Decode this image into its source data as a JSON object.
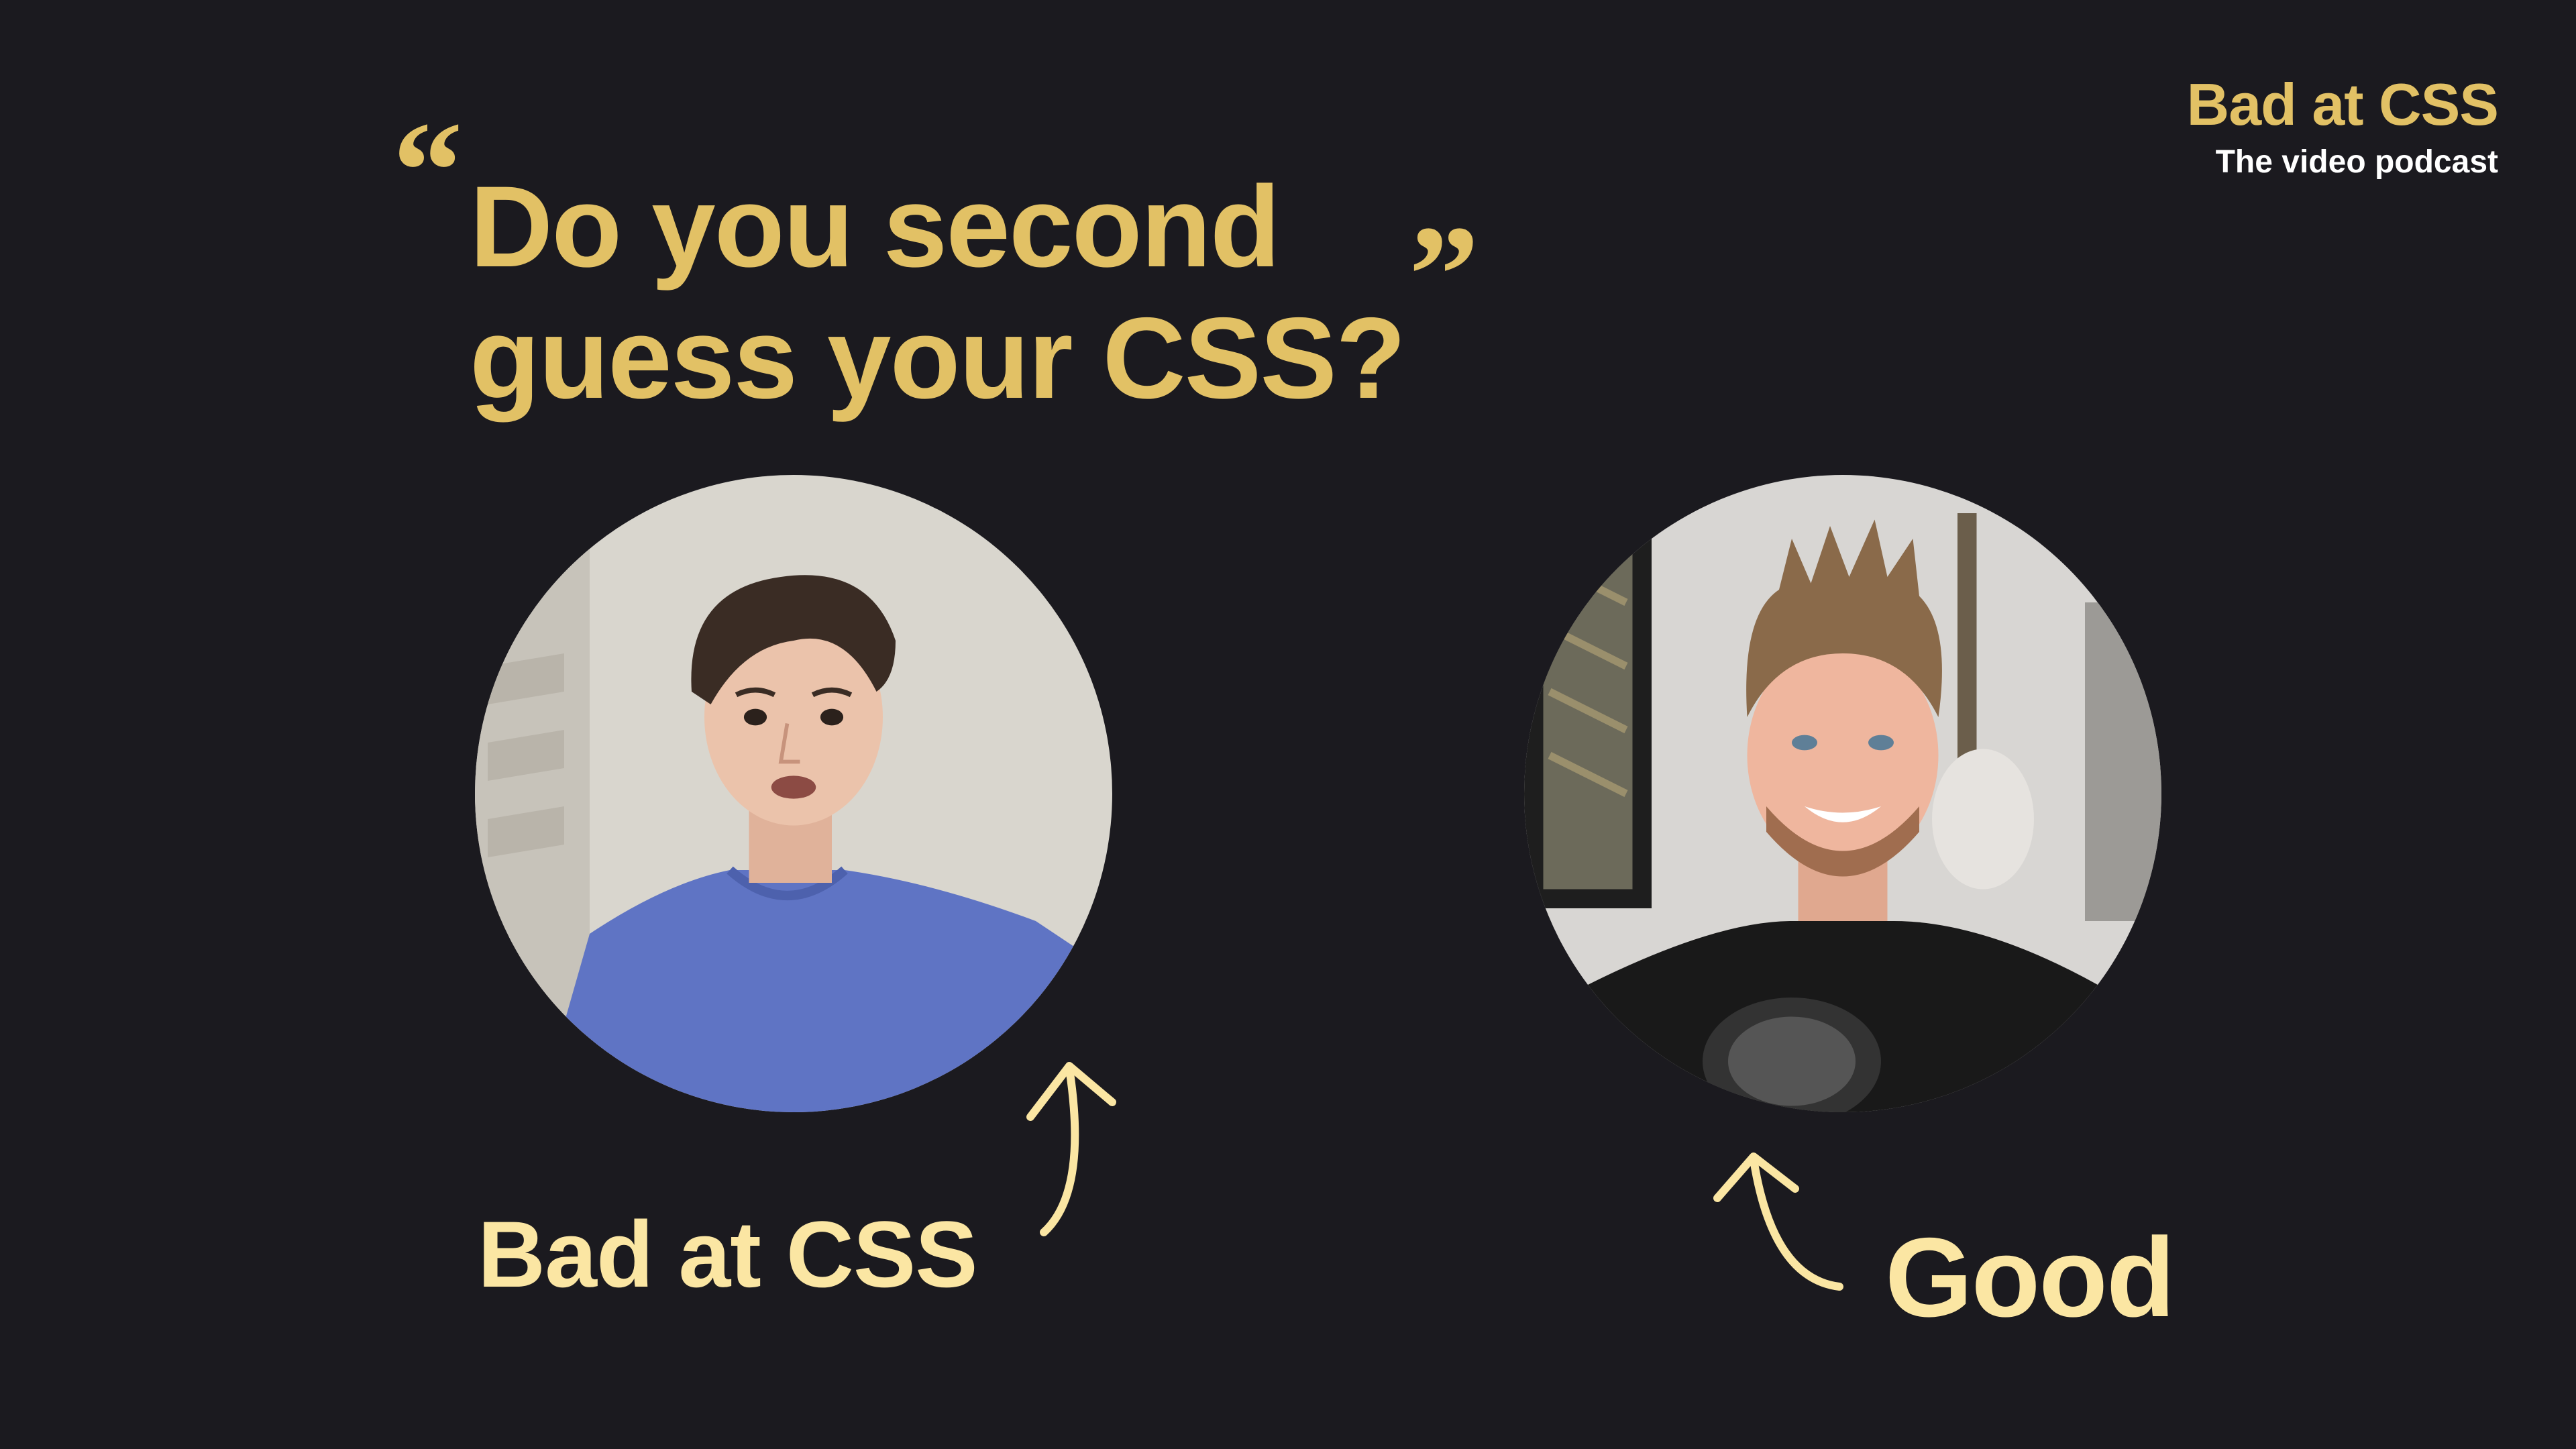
{
  "brand": {
    "title": "Bad at CSS",
    "subtitle": "The video podcast"
  },
  "headline": {
    "open_quote": "“",
    "line1": "Do you second",
    "line2": "guess your CSS?",
    "close_quote": "”"
  },
  "hosts": [
    {
      "label": "Bad at CSS"
    },
    {
      "label": "Good"
    }
  ],
  "colors": {
    "background": "#1b1a1f",
    "accent": "#e2c165",
    "label": "#fbe6a3",
    "subtitle": "#ffffff"
  }
}
